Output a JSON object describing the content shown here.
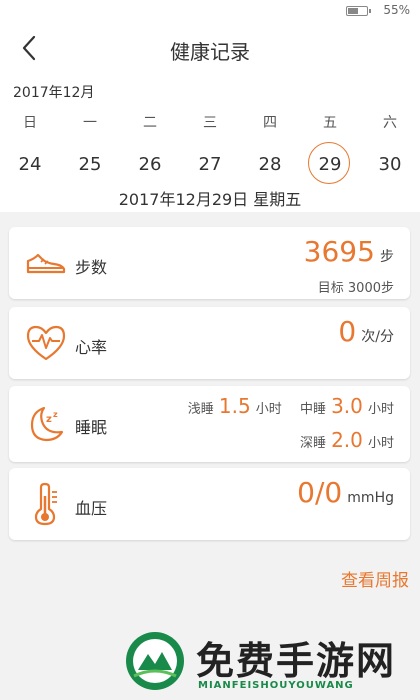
{
  "status_bar": {
    "battery_percent_text": "55%",
    "battery_level": 0.55
  },
  "header": {
    "title": "健康记录"
  },
  "calendar": {
    "month": "2017年12月",
    "weekdays": [
      "日",
      "一",
      "二",
      "三",
      "四",
      "五",
      "六"
    ],
    "days": [
      "24",
      "25",
      "26",
      "27",
      "28",
      "29",
      "30"
    ],
    "selected_day": "29",
    "selected_date_text": "2017年12月29日 星期五"
  },
  "cards": {
    "steps": {
      "title": "步数",
      "value": "3695",
      "unit": "步",
      "goal": "目标 3000步"
    },
    "heart_rate": {
      "title": "心率",
      "value": "0",
      "unit": "次/分"
    },
    "sleep": {
      "title": "睡眠",
      "light_label": "浅睡",
      "light_value": "1.5",
      "light_unit": "小时",
      "medium_label": "中睡",
      "medium_value": "3.0",
      "medium_unit": "小时",
      "deep_label": "深睡",
      "deep_value": "2.0",
      "deep_unit": "小时"
    },
    "blood_pressure": {
      "title": "血压",
      "value": "0/0",
      "unit": "mmHg"
    }
  },
  "weekly_report_link": "查看周报",
  "watermark": {
    "title": "免费手游网",
    "subtitle": "MIANFEISHOUYOUWANG"
  },
  "colors": {
    "accent": "#e87830",
    "background": "#f2f2f2",
    "card": "#ffffff"
  }
}
